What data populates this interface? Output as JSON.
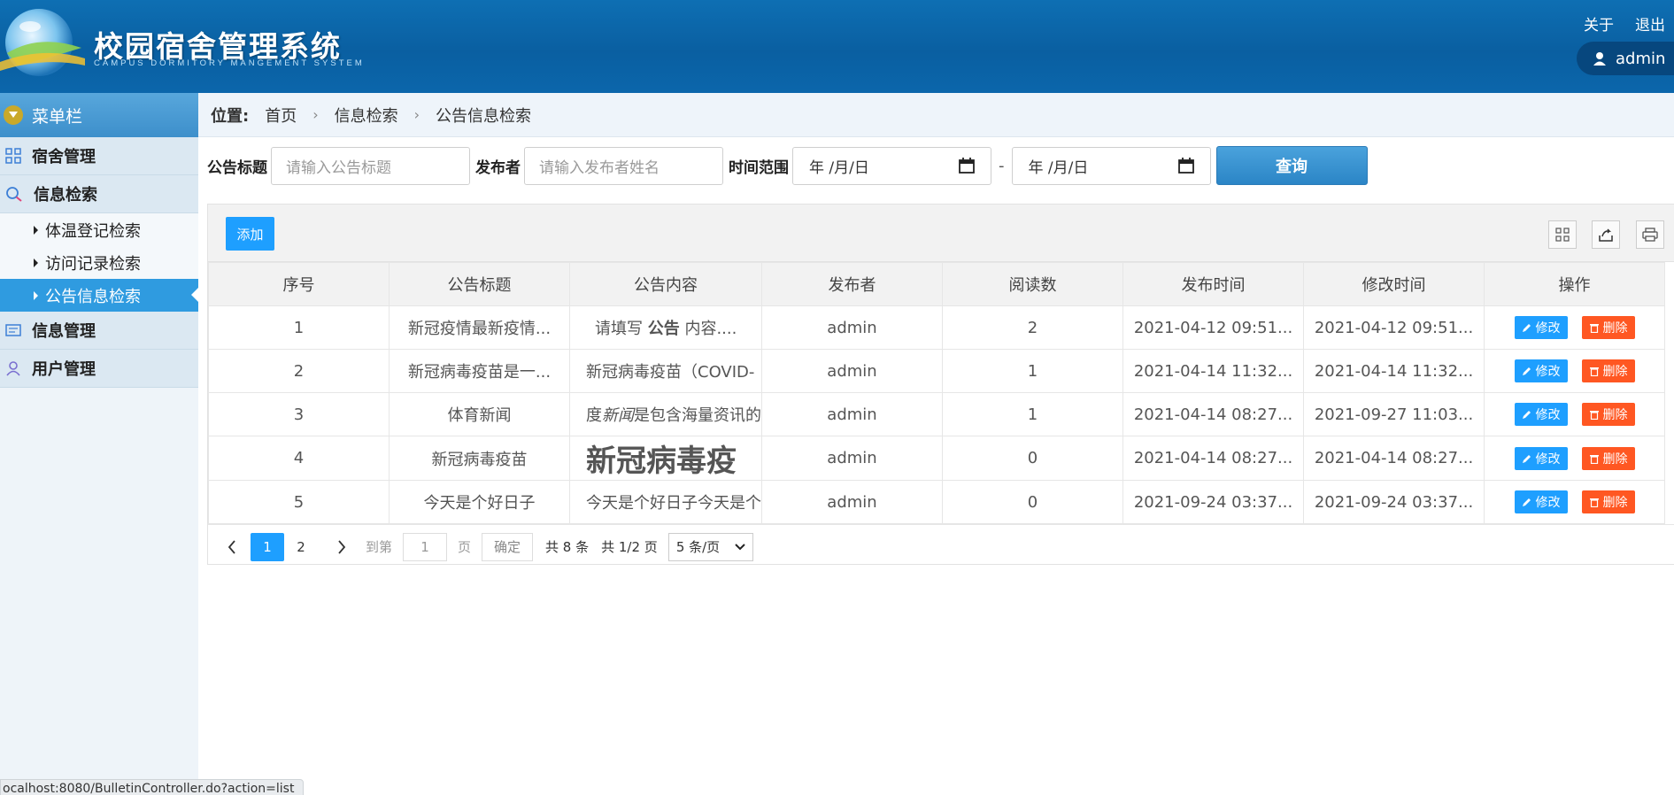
{
  "header": {
    "title": "校园宿舍管理系统",
    "subtitle": "CAMPUS DORMITORY MANGEMENT SYSTEM",
    "about": "关于",
    "logout": "退出",
    "user": "admin"
  },
  "sidebar": {
    "menu_title": "菜单栏",
    "groups": [
      {
        "label": "宿舍管理",
        "icon": "grid-icon"
      },
      {
        "label": "信息检索",
        "icon": "search-icon"
      },
      {
        "label": "信息管理",
        "icon": "card-icon"
      },
      {
        "label": "用户管理",
        "icon": "user-icon"
      }
    ],
    "sub_items": [
      {
        "label": "体温登记检索"
      },
      {
        "label": "访问记录检索"
      },
      {
        "label": "公告信息检索",
        "active": true
      }
    ]
  },
  "breadcrumb": {
    "label": "位置:",
    "items": [
      "首页",
      "信息检索",
      "公告信息检索"
    ]
  },
  "search": {
    "title_label": "公告标题",
    "title_placeholder": "请输入公告标题",
    "publisher_label": "发布者",
    "publisher_placeholder": "请输入发布者姓名",
    "time_label": "时间范围",
    "date_start": "年 /月/日",
    "date_end": "年 /月/日",
    "date_sep": "-",
    "query_button": "查询"
  },
  "toolbar": {
    "add_button": "添加"
  },
  "table": {
    "columns": [
      "序号",
      "公告标题",
      "公告内容",
      "发布者",
      "阅读数",
      "发布时间",
      "修改时间",
      "操作"
    ],
    "rows": [
      {
        "no": "1",
        "title": "新冠疫情最新疫情...",
        "content_pre": "请填写 ",
        "content_bold": "公告",
        "content_post": " 内容....",
        "publisher": "admin",
        "reads": "2",
        "published": "2021-04-12 09:51...",
        "modified": "2021-04-12 09:51..."
      },
      {
        "no": "2",
        "title": "新冠病毒疫苗是一...",
        "content": "新冠病毒疫苗（COVID-",
        "publisher": "admin",
        "reads": "1",
        "published": "2021-04-14 11:32...",
        "modified": "2021-04-14 11:32..."
      },
      {
        "no": "3",
        "title": "体育新闻",
        "content_pre": "度",
        "content_italic": "新闻",
        "content_post": "是包含海量资讯的",
        "publisher": "admin",
        "reads": "1",
        "published": "2021-04-14 08:27...",
        "modified": "2021-09-27 11:03..."
      },
      {
        "no": "4",
        "title": "新冠病毒疫苗",
        "content_big": "新冠病毒疫",
        "publisher": "admin",
        "reads": "0",
        "published": "2021-04-14 08:27...",
        "modified": "2021-04-14 08:27..."
      },
      {
        "no": "5",
        "title": "今天是个好日子",
        "content": "今天是个好日子今天是个",
        "publisher": "admin",
        "reads": "0",
        "published": "2021-09-24 03:37...",
        "modified": "2021-09-24 03:37..."
      }
    ],
    "edit_label": "修改",
    "delete_label": "删除"
  },
  "pager": {
    "pages": [
      "1",
      "2"
    ],
    "current": "1",
    "goto_label": "到第",
    "goto_value": "1",
    "page_unit": "页",
    "confirm": "确定",
    "total": "共 8 条",
    "page_count": "共 1/2 页",
    "page_size": "5 条/页"
  },
  "status_bar": {
    "url": "ocalhost:8080/BulletinController.do?action=list"
  }
}
